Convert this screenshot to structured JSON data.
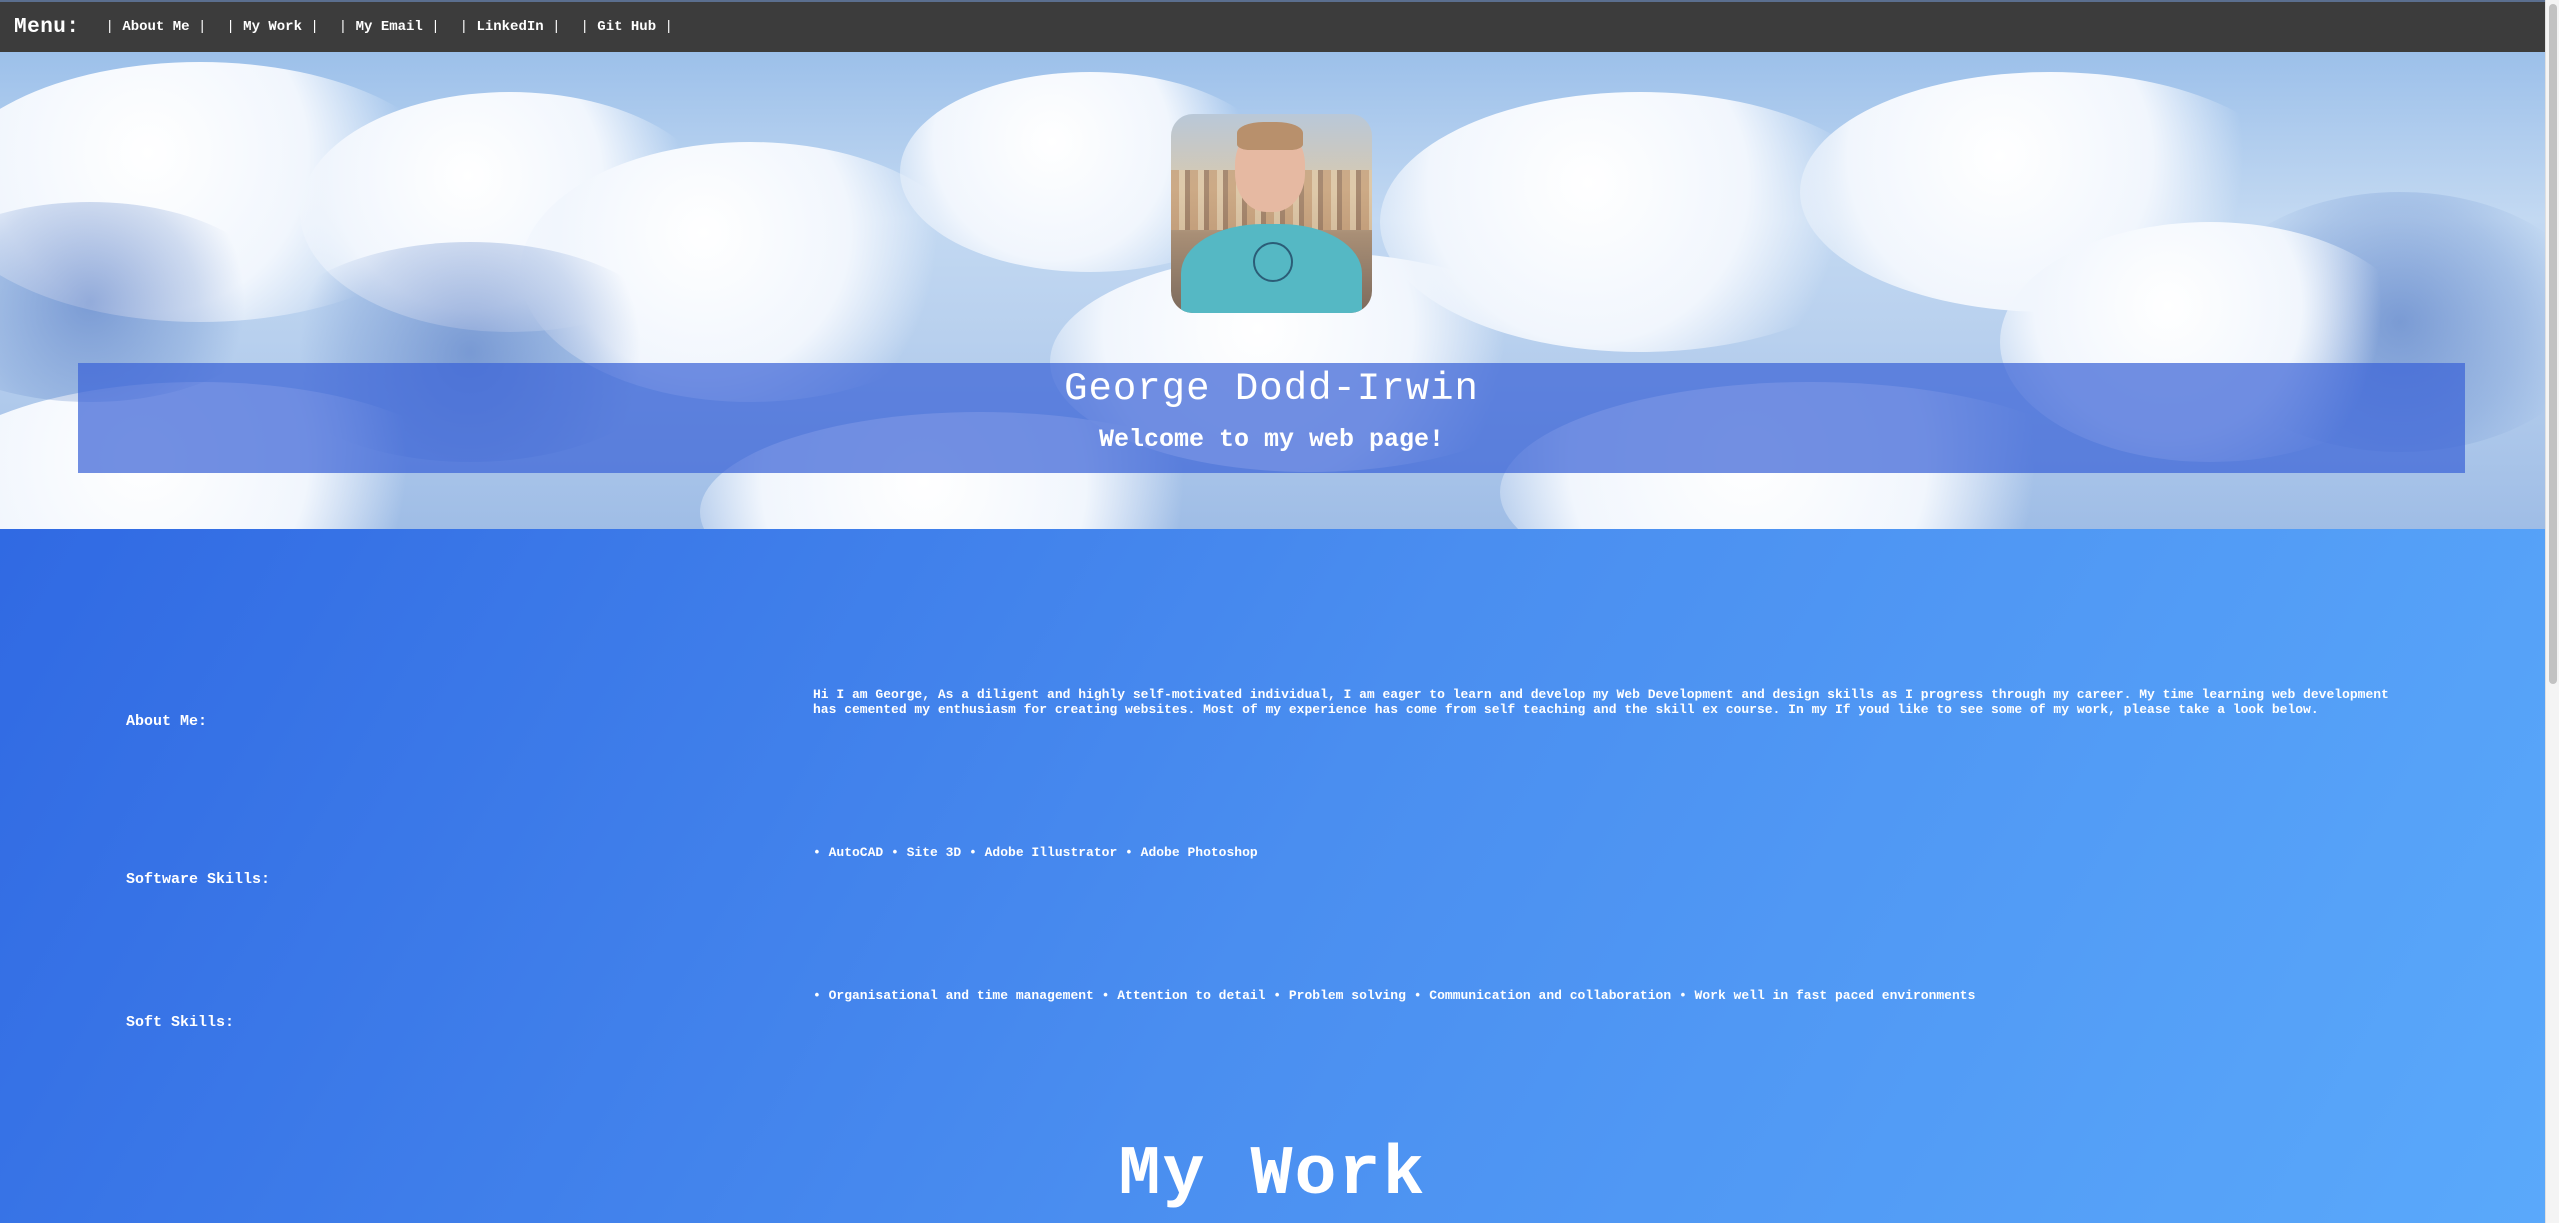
{
  "nav": {
    "menu_label": "Menu:",
    "items": [
      {
        "label": "About Me"
      },
      {
        "label": "My Work"
      },
      {
        "label": "My Email"
      },
      {
        "label": "LinkedIn"
      },
      {
        "label": "Git Hub"
      }
    ]
  },
  "hero": {
    "name": "George Dodd-Irwin",
    "welcome": "Welcome to my web page!"
  },
  "sections": {
    "about": {
      "label": "About Me:",
      "text": "Hi I am George, As a diligent and highly self-motivated individual, I am eager to learn and develop my Web Development and design skills as I progress through my career. My time learning web development has cemented my enthusiasm for creating websites. Most of my experience has come from self teaching and the skill ex course. In my If youd like to see some of my work, please take a look below."
    },
    "software": {
      "label": "Software Skills:",
      "text": "• AutoCAD • Site 3D • Adobe Illustrator • Adobe Photoshop"
    },
    "soft": {
      "label": "Soft Skills:",
      "text": "• Organisational and time management • Attention to detail • Problem solving • Communication and collaboration • Work well in fast paced environments"
    }
  },
  "mywork": {
    "title": "My Work"
  },
  "colors": {
    "nav_bg": "#3c3c3c",
    "banner_bg": "#3c64d7",
    "content_gradient_start": "#2b62e0",
    "content_gradient_end": "#5aa9fb"
  }
}
